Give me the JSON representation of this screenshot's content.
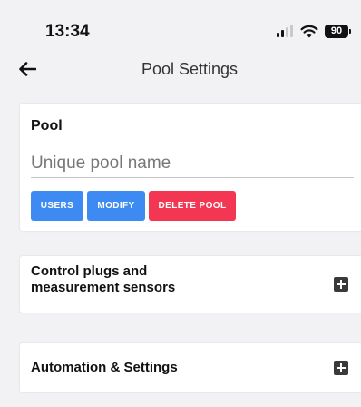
{
  "status_bar": {
    "time": "13:34",
    "battery_level": "90",
    "icons": [
      "cellular-signal-icon",
      "wifi-icon",
      "battery-icon"
    ]
  },
  "header": {
    "back_icon": "arrow-left-icon",
    "title": "Pool Settings"
  },
  "pool_card": {
    "title": "Pool",
    "name_input": {
      "placeholder": "Unique pool name",
      "value": ""
    },
    "buttons": {
      "users": "USERS",
      "modify": "MODIFY",
      "delete": "DELETE POOL"
    }
  },
  "sections": [
    {
      "title_line1": "Control plugs and",
      "title_line2": "measurement sensors",
      "icon": "plus-square-icon"
    },
    {
      "title": "Automation & Settings",
      "icon": "plus-square-icon"
    }
  ],
  "colors": {
    "primary_button": "#3d8bf2",
    "danger_button": "#f33651",
    "background": "#f2f2f4",
    "card": "#ffffff"
  }
}
